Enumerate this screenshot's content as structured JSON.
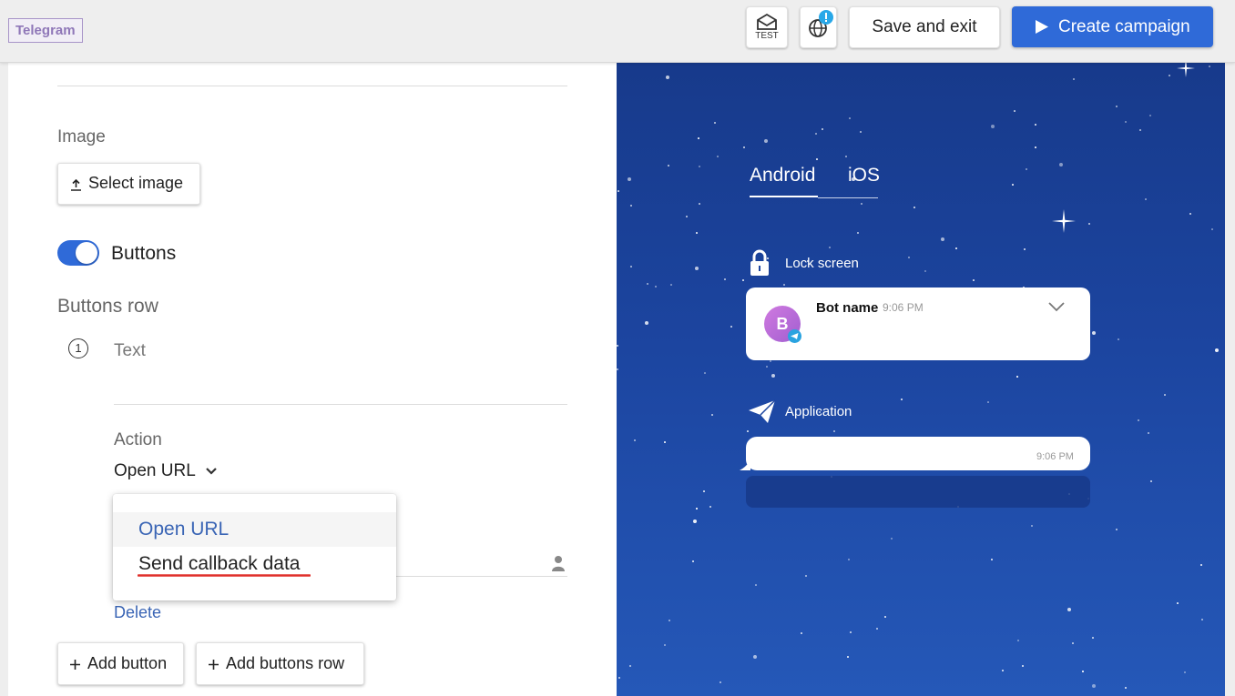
{
  "topbar": {
    "tag": "Telegram",
    "test_label": "TEST",
    "save_exit": "Save and exit",
    "create_campaign": "Create campaign"
  },
  "form": {
    "image_label": "Image",
    "select_image": "Select image",
    "buttons_toggle_label": "Buttons",
    "buttons_toggle_on": true,
    "buttons_row_label": "Buttons row",
    "row_number": "1",
    "text_placeholder": "Text",
    "action_label": "Action",
    "action_value": "Open URL",
    "action_options": [
      "Open URL",
      "Send callback data"
    ],
    "delete": "Delete",
    "add_button": "Add button",
    "add_buttons_row": "Add buttons row"
  },
  "preview": {
    "tabs": [
      "Android",
      "iOS"
    ],
    "active_tab": "Android",
    "lock_screen_label": "Lock screen",
    "bot_initial": "B",
    "bot_name": "Bot name",
    "lock_time": "9:06 PM",
    "application_label": "Application",
    "app_time": "9:06 PM"
  },
  "colors": {
    "accent": "#2f6ad8",
    "tag_purple": "#8f77b8",
    "preview_bg": "#1c45a0",
    "avatar": "#b56bd6",
    "underline": "#e0302c"
  }
}
